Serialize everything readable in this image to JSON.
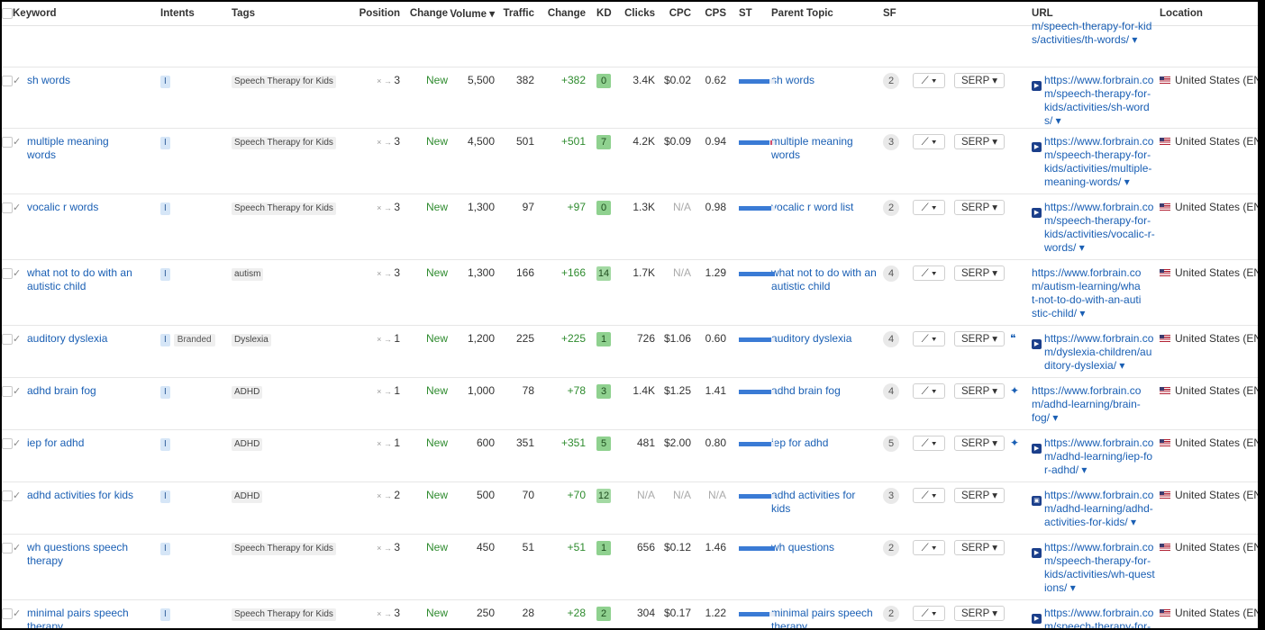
{
  "headers": {
    "keyword": "Keyword",
    "intents": "Intents",
    "tags": "Tags",
    "position": "Position",
    "change": "Change",
    "volume": "Volume ▾",
    "traffic": "Traffic",
    "traffic_change": "Change",
    "kd": "KD",
    "clicks": "Clicks",
    "cpc": "CPC",
    "cps": "CPS",
    "st": "ST",
    "parent_topic": "Parent Topic",
    "sf": "SF",
    "url": "URL",
    "location": "Location"
  },
  "top_partial_url": "m/speech-therapy-for-kid s/activities/th-words/ ▾",
  "labels": {
    "serp": "SERP ▾",
    "trend": "⟋ ▾",
    "arrow": "× → ",
    "location": "United States (EN)"
  },
  "rows": [
    {
      "keyword": "sh words",
      "intent": "I",
      "branded": "",
      "tag": "Speech Therapy for Kids",
      "position": "3",
      "change": "New",
      "volume": "5,500",
      "traffic": "382",
      "traffic_change": "+382",
      "kd": "0",
      "clicks": "3.4K",
      "cpc": "$0.02",
      "cps": "0.62",
      "st": 0.85,
      "parent_topic": "sh words",
      "sf": "2",
      "url": "https://www.forbrain.com/speech-therapy-for-kids/activities/sh-words/ ▾",
      "url_icon": "video",
      "location": "United States (EN)"
    },
    {
      "keyword": "multiple meaning words",
      "intent": "I",
      "branded": "",
      "tag": "Speech Therapy for Kids",
      "position": "3",
      "change": "New",
      "volume": "4,500",
      "traffic": "501",
      "traffic_change": "+501",
      "kd": "7",
      "clicks": "4.2K",
      "cpc": "$0.09",
      "cps": "0.94",
      "st": 0.85,
      "parent_topic": "multiple meaning words",
      "sf": "3",
      "url": "https://www.forbrain.com/speech-therapy-for-kids/activities/multiple-meaning-words/ ▾",
      "url_icon": "video",
      "location": "United States (EN)"
    },
    {
      "keyword": "vocalic r words",
      "intent": "I",
      "branded": "",
      "tag": "Speech Therapy for Kids",
      "position": "3",
      "change": "New",
      "volume": "1,300",
      "traffic": "97",
      "traffic_change": "+97",
      "kd": "0",
      "clicks": "1.3K",
      "cpc": "N/A",
      "cps": "0.98",
      "st": 0.9,
      "parent_topic": "vocalic r word list",
      "sf": "2",
      "url": "https://www.forbrain.com/speech-therapy-for-kids/activities/vocalic-r-words/ ▾",
      "url_icon": "video",
      "location": "United States (EN)"
    },
    {
      "keyword": "what not to do with an autistic child",
      "intent": "I",
      "branded": "",
      "tag": "autism",
      "position": "3",
      "change": "New",
      "volume": "1,300",
      "traffic": "166",
      "traffic_change": "+166",
      "kd": "14",
      "clicks": "1.7K",
      "cpc": "N/A",
      "cps": "1.29",
      "st": 1.0,
      "parent_topic": "what not to do with an autistic child",
      "sf": "4",
      "url": "https://www.forbrain.com/autism-learning/what-not-to-do-with-an-autistic-child/ ▾",
      "url_icon": "",
      "location": "United States (EN)"
    },
    {
      "keyword": "auditory dyslexia",
      "intent": "I",
      "branded": "Branded",
      "tag": "Dyslexia",
      "position": "1",
      "change": "New",
      "volume": "1,200",
      "traffic": "225",
      "traffic_change": "+225",
      "kd": "1",
      "clicks": "726",
      "cpc": "$1.06",
      "cps": "0.60",
      "st": 0.9,
      "parent_topic": "auditory dyslexia",
      "sf": "4",
      "url": "https://www.forbrain.com/dyslexia-children/auditory-dyslexia/ ▾",
      "url_icon": "video",
      "url_extra": "❝",
      "location": "United States (EN)"
    },
    {
      "keyword": "adhd brain fog",
      "intent": "I",
      "branded": "",
      "tag": "ADHD",
      "position": "1",
      "change": "New",
      "volume": "1,000",
      "traffic": "78",
      "traffic_change": "+78",
      "kd": "3",
      "clicks": "1.4K",
      "cpc": "$1.25",
      "cps": "1.41",
      "st": 0.9,
      "parent_topic": "adhd brain fog",
      "sf": "4",
      "url": "https://www.forbrain.com/adhd-learning/brain-fog/ ▾",
      "url_icon": "",
      "url_extra": "✦",
      "location": "United States (EN)"
    },
    {
      "keyword": "iep for adhd",
      "intent": "I",
      "branded": "",
      "tag": "ADHD",
      "position": "1",
      "change": "New",
      "volume": "600",
      "traffic": "351",
      "traffic_change": "+351",
      "kd": "5",
      "clicks": "481",
      "cpc": "$2.00",
      "cps": "0.80",
      "st": 0.9,
      "parent_topic": "iep for adhd",
      "sf": "5",
      "url": "https://www.forbrain.com/adhd-learning/iep-for-adhd/ ▾",
      "url_icon": "video",
      "url_extra": "✦",
      "location": "United States (EN)"
    },
    {
      "keyword": "adhd activities for kids",
      "intent": "I",
      "branded": "",
      "tag": "ADHD",
      "position": "2",
      "change": "New",
      "volume": "500",
      "traffic": "70",
      "traffic_change": "+70",
      "kd": "12",
      "clicks": "N/A",
      "cpc": "N/A",
      "cps": "N/A",
      "st": 0.9,
      "parent_topic": "adhd activities for kids",
      "sf": "3",
      "url": "https://www.forbrain.com/adhd-learning/adhd-activities-for-kids/ ▾",
      "url_icon": "image",
      "location": "United States (EN)"
    },
    {
      "keyword": "wh questions speech therapy",
      "intent": "I",
      "branded": "",
      "tag": "Speech Therapy for Kids",
      "position": "3",
      "change": "New",
      "volume": "450",
      "traffic": "51",
      "traffic_change": "+51",
      "kd": "1",
      "clicks": "656",
      "cpc": "$0.12",
      "cps": "1.46",
      "st": 1.0,
      "parent_topic": "wh questions",
      "sf": "2",
      "url": "https://www.forbrain.com/speech-therapy-for-kids/activities/wh-questions/ ▾",
      "url_icon": "video",
      "location": "United States (EN)"
    },
    {
      "keyword": "minimal pairs speech therapy",
      "intent": "I",
      "branded": "",
      "tag": "Speech Therapy for Kids",
      "position": "3",
      "change": "New",
      "volume": "250",
      "traffic": "28",
      "traffic_change": "+28",
      "kd": "2",
      "clicks": "304",
      "cpc": "$0.17",
      "cps": "1.22",
      "st": 0.85,
      "parent_topic": "minimal pairs speech therapy",
      "sf": "2",
      "url": "https://www.forbrain.com/speech-therapy-for-kids/activities/minimal-pairs/ ▾",
      "url_icon": "video",
      "location": "United States (EN)"
    }
  ]
}
